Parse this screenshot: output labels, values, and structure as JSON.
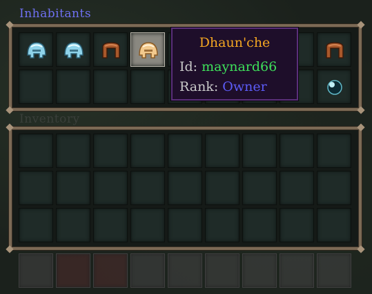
{
  "inhabitants": {
    "title": "Inhabitants",
    "row1_icons": [
      "cyan-helmet-icon",
      "cyan-helmet-icon",
      "brown-helmet-icon",
      "tan-helmet-icon",
      "",
      "",
      "",
      "",
      "brown-helmet-icon"
    ],
    "selected_index": 3,
    "row2_icons": [
      "",
      "",
      "",
      "",
      "",
      "",
      "",
      "",
      "dark-orb-icon"
    ]
  },
  "inventory": {
    "title": "Inventory",
    "rows": 3,
    "cols": 9
  },
  "tooltip": {
    "name": "Dhaun'che",
    "id_label": "Id:",
    "id_value": "maynard66",
    "rank_label": "Rank:",
    "rank_value": "Owner"
  },
  "colors": {
    "title_blue": "#6f70f2",
    "name_orange": "#f4a622",
    "id_green": "#3ee05a",
    "rank_blue": "#5c5cf7"
  }
}
